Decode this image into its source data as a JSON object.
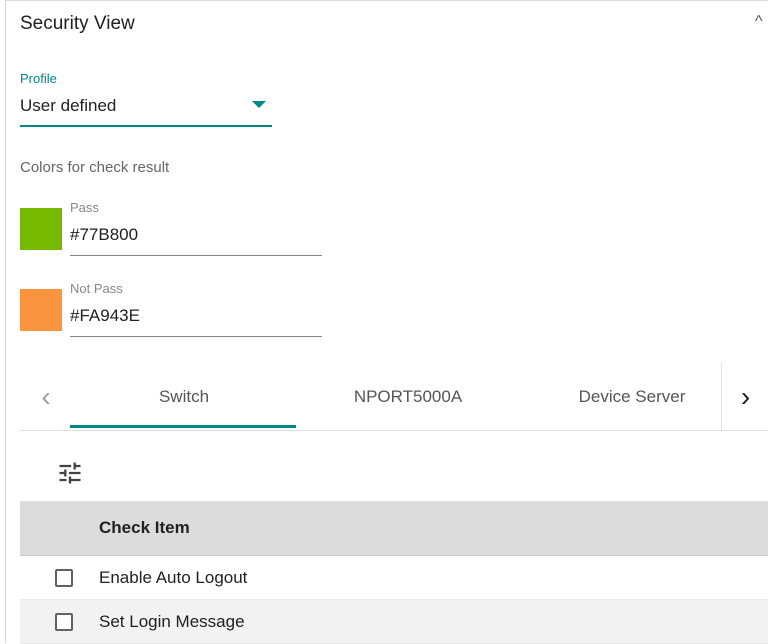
{
  "section": {
    "title": "Security View",
    "collapse_icon": "chevron-up-icon"
  },
  "profile": {
    "label": "Profile",
    "value": "User defined"
  },
  "colors": {
    "title": "Colors for check result",
    "pass": {
      "label": "Pass",
      "value": "#77B800",
      "swatch": "#77B800"
    },
    "not_pass": {
      "label": "Not Pass",
      "value": "#FA943E",
      "swatch": "#FA943E"
    }
  },
  "tabs": {
    "items": [
      {
        "label": "Switch",
        "active": true
      },
      {
        "label": "NPORT5000A",
        "active": false
      },
      {
        "label": "Device Server",
        "active": false
      }
    ],
    "prev_icon": "chevron-left-icon",
    "next_icon": "chevron-right-icon",
    "accent": "#008787"
  },
  "toolbar": {
    "filter_icon": "tune-icon"
  },
  "table": {
    "header": "Check Item",
    "rows": [
      {
        "label": "Enable Auto Logout",
        "checked": false
      },
      {
        "label": "Set Login Message",
        "checked": false
      }
    ]
  }
}
